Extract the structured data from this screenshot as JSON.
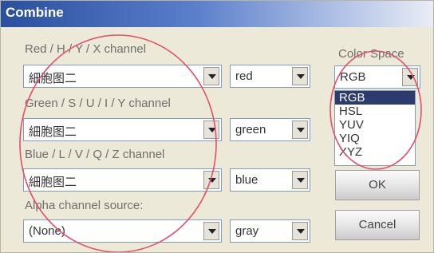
{
  "window": {
    "title": "Combine"
  },
  "channels": [
    {
      "label": "Red / H / Y / X channel",
      "source": "細胞图二",
      "color": "red"
    },
    {
      "label": "Green / S / U / I / Y channel",
      "source": "細胞图二",
      "color": "green"
    },
    {
      "label": "Blue / L / V / Q / Z channel",
      "source": "細胞图二",
      "color": "blue"
    },
    {
      "label": "Alpha channel source:",
      "source": "(None)",
      "color": "gray"
    }
  ],
  "color_space": {
    "label": "Color Space",
    "value": "RGB",
    "options": [
      "RGB",
      "HSL",
      "YUV",
      "YIQ",
      "XYZ"
    ]
  },
  "buttons": {
    "ok": "OK",
    "cancel": "Cancel"
  },
  "annotation_color": "#e0506a"
}
